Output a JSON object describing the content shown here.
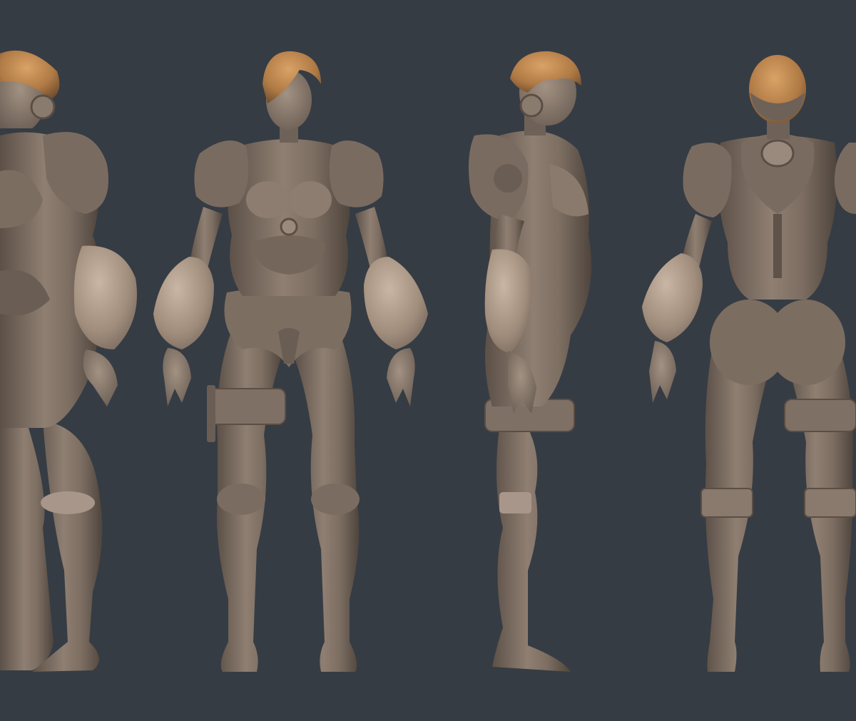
{
  "scene": {
    "background_color": "#363c44",
    "clay_color": "#8a7a6d",
    "clay_light_color": "#b6a391",
    "clay_dark_color": "#5f5248",
    "hair_color": "#c2894f",
    "views": [
      {
        "view": "three-quarter-left"
      },
      {
        "view": "front"
      },
      {
        "view": "side-right"
      },
      {
        "view": "back"
      }
    ]
  }
}
